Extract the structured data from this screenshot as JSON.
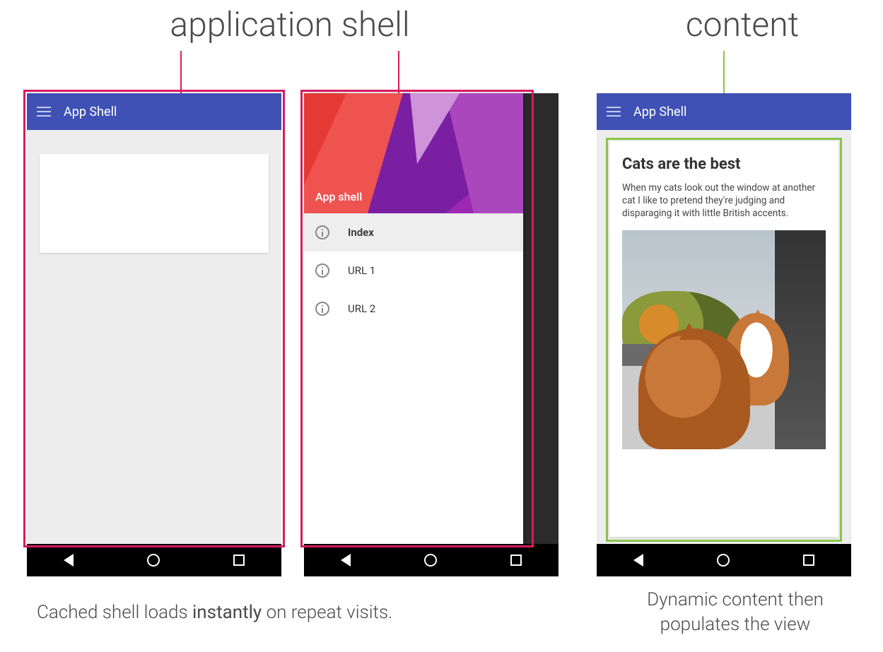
{
  "labels": {
    "app_shell_heading": "application shell",
    "content_heading": "content"
  },
  "captions": {
    "left_pre": "Cached shell loads ",
    "left_bold": "instantly",
    "left_post": " on repeat visits.",
    "right": "Dynamic content then populates the view"
  },
  "colors": {
    "outline_pink": "#d81b60",
    "outline_green": "#8bc34a",
    "appbar": "#3f51b5"
  },
  "phone1": {
    "appbar_title": "App Shell"
  },
  "phone2": {
    "drawer_header_title": "App shell",
    "items": [
      {
        "label": "Index",
        "active": true
      },
      {
        "label": "URL 1",
        "active": false
      },
      {
        "label": "URL 2",
        "active": false
      }
    ]
  },
  "phone3": {
    "appbar_title": "App Shell",
    "article_title": "Cats are the best",
    "article_body": "When my cats look out the window at another cat I like to pretend they're judging and disparaging it with little British accents."
  }
}
